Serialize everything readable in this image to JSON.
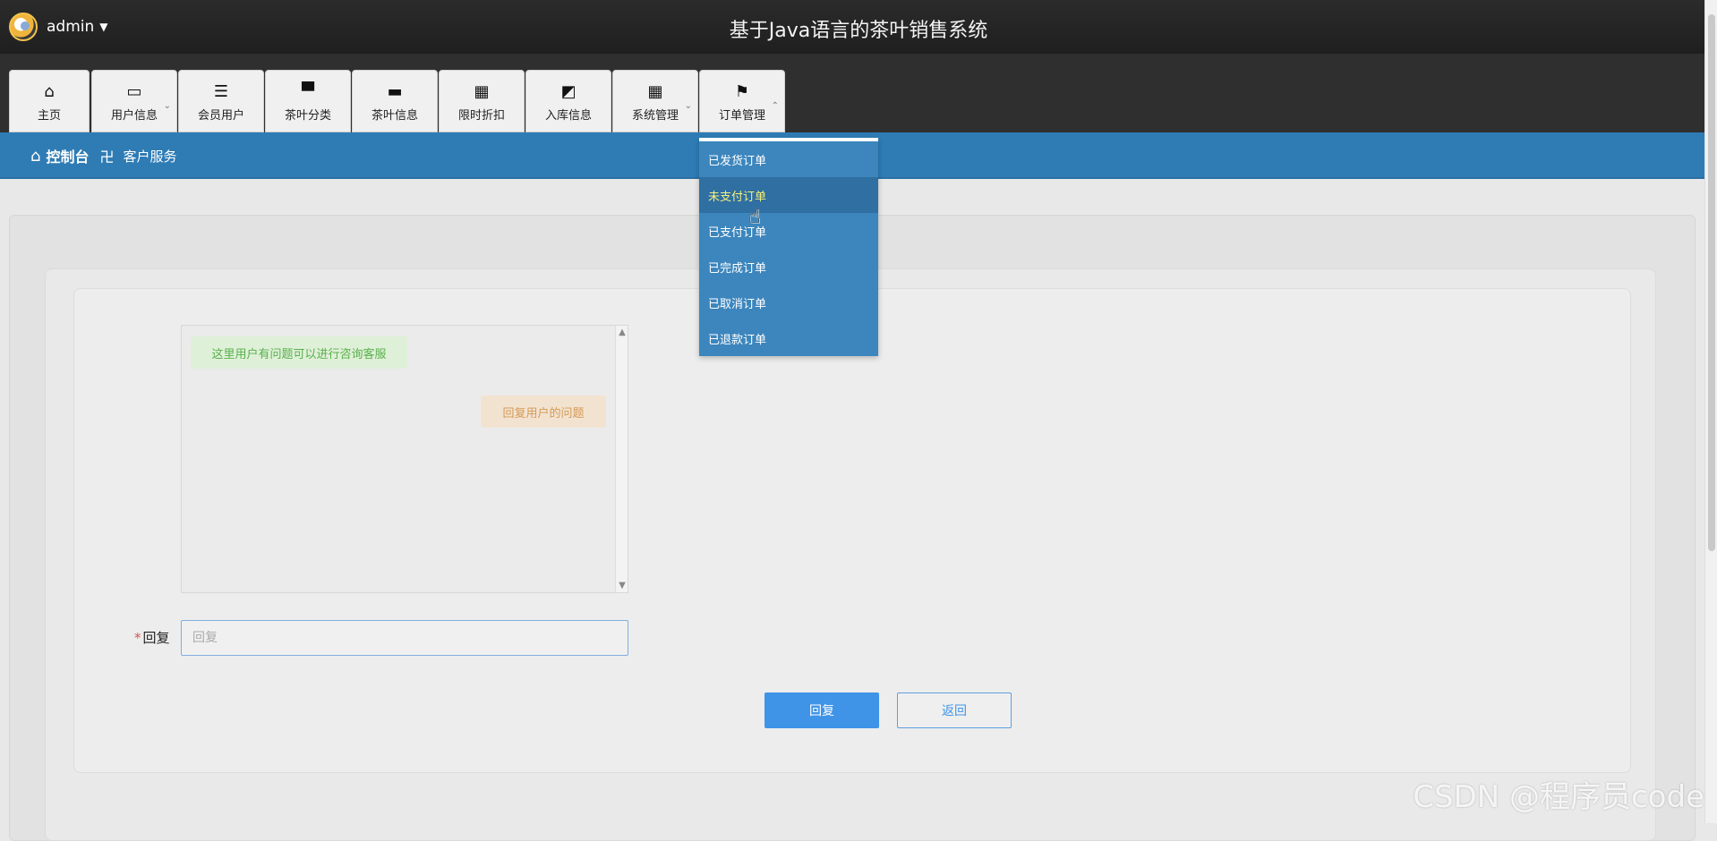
{
  "header": {
    "username": "admin",
    "system_title": "基于Java语言的茶叶销售系统"
  },
  "nav": {
    "items": [
      {
        "label": "主页",
        "icon": "home-icon"
      },
      {
        "label": "用户信息",
        "icon": "card-icon"
      },
      {
        "label": "会员用户",
        "icon": "list-icon"
      },
      {
        "label": "茶叶分类",
        "icon": "monitor-icon"
      },
      {
        "label": "茶叶信息",
        "icon": "chat-icon"
      },
      {
        "label": "限时折扣",
        "icon": "grid-icon"
      },
      {
        "label": "入库信息",
        "icon": "wallet-icon"
      },
      {
        "label": "系统管理",
        "icon": "grid-icon"
      },
      {
        "label": "订单管理",
        "icon": "flag-icon"
      }
    ]
  },
  "dropdown": {
    "items": [
      {
        "label": "已发货订单"
      },
      {
        "label": "未支付订单"
      },
      {
        "label": "已支付订单"
      },
      {
        "label": "已完成订单"
      },
      {
        "label": "已取消订单"
      },
      {
        "label": "已退款订单"
      }
    ]
  },
  "breadcrumb": {
    "root": "控制台",
    "current": "客户服务"
  },
  "chat": {
    "user_message": "这里用户有问题可以进行咨询客服",
    "admin_message": "回复用户的问题"
  },
  "form": {
    "reply_label": "回复",
    "reply_placeholder": "回复",
    "submit_label": "回复",
    "back_label": "返回"
  },
  "watermark": "CSDN @程序员code"
}
